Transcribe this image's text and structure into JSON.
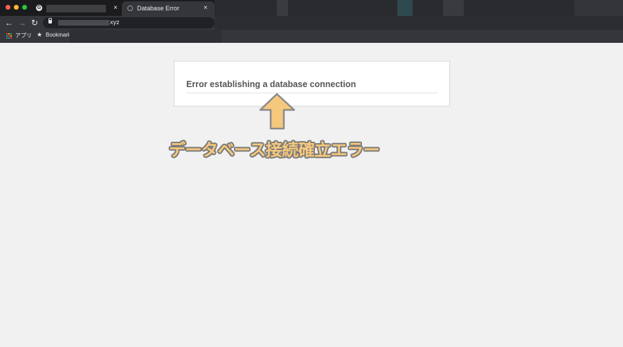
{
  "browser": {
    "tabs": [
      {
        "title": "",
        "favicon": "google-g-icon",
        "active": false
      },
      {
        "title": "Database Error",
        "favicon": "globe-icon",
        "active": true
      }
    ],
    "close_glyph": "×",
    "url_suffix": "xyz",
    "bookmarks": {
      "apps_label": "アプリ",
      "bookmarks_label": "Bookmarks"
    },
    "nav": {
      "back": "←",
      "forward": "→",
      "reload": "↻"
    },
    "traffic_lights": [
      "#ff5f57",
      "#febc2e",
      "#28c840"
    ]
  },
  "page": {
    "error_heading": "Error establishing a database connection"
  },
  "annotation": {
    "caption": "データベース接続確立エラー",
    "arrow_color": "#f6c87d"
  }
}
